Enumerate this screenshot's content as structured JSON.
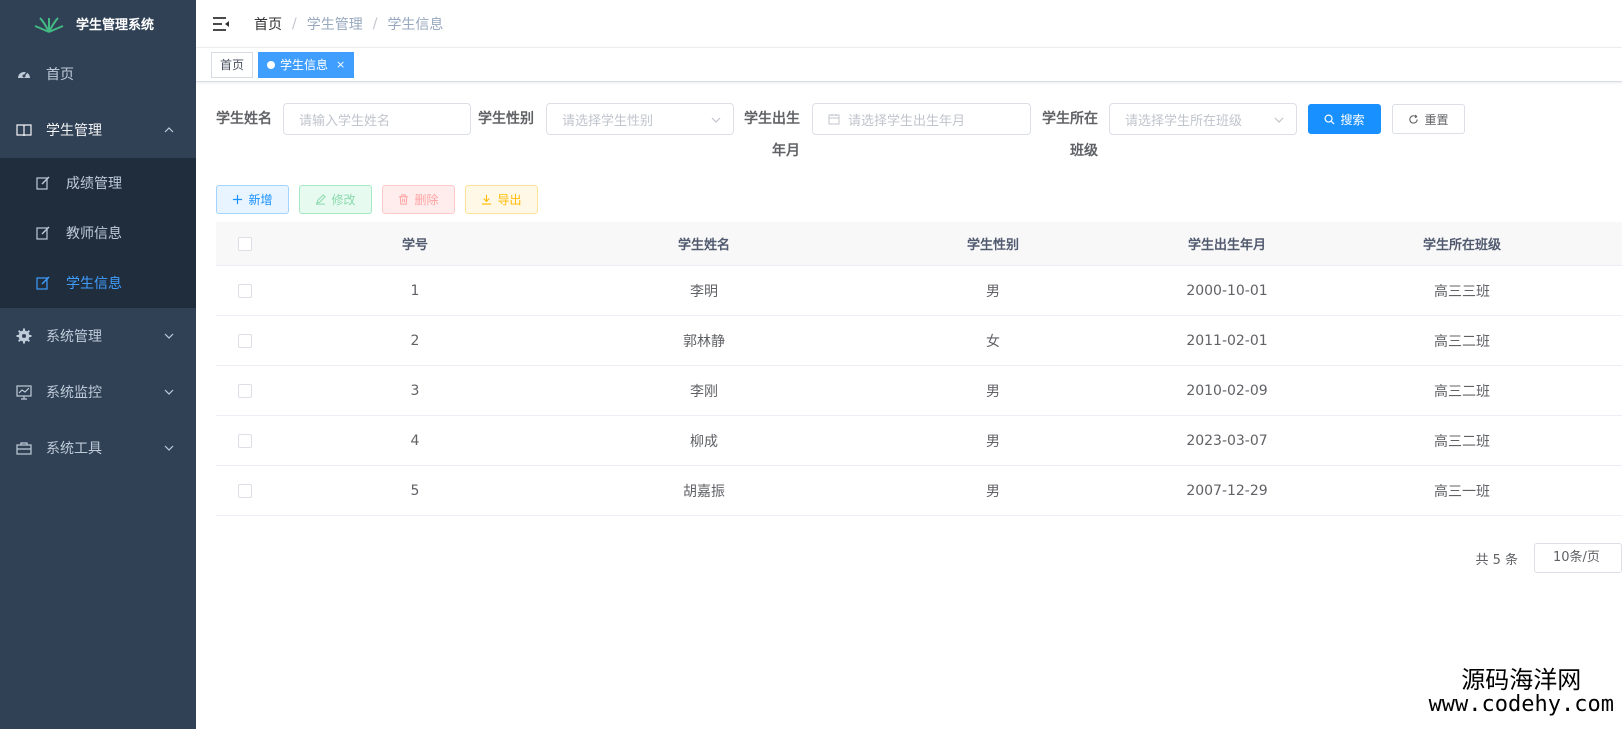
{
  "app": {
    "title": "学生管理系统"
  },
  "sidebar": {
    "items": [
      {
        "label": "首页",
        "icon": "dashboard-icon"
      },
      {
        "label": "学生管理",
        "icon": "book-icon",
        "expanded": true,
        "children": [
          {
            "label": "成绩管理",
            "icon": "edit-icon"
          },
          {
            "label": "教师信息",
            "icon": "edit-icon"
          },
          {
            "label": "学生信息",
            "icon": "edit-icon",
            "active": true
          }
        ]
      },
      {
        "label": "系统管理",
        "icon": "gear-icon"
      },
      {
        "label": "系统监控",
        "icon": "monitor-icon"
      },
      {
        "label": "系统工具",
        "icon": "toolbox-icon"
      }
    ]
  },
  "breadcrumb": [
    "首页",
    "学生管理",
    "学生信息"
  ],
  "tags": [
    {
      "label": "首页",
      "active": false
    },
    {
      "label": "学生信息",
      "active": true,
      "close": "×"
    }
  ],
  "search": {
    "name_label": "学生姓名",
    "name_placeholder": "请输入学生姓名",
    "gender_label": "学生性别",
    "gender_placeholder": "请选择学生性别",
    "birth_label_line1": "学生出生",
    "birth_label_line2": "年月",
    "birth_placeholder": "请选择学生出生年月",
    "class_label_line1": "学生所在",
    "class_label_line2": "班级",
    "class_placeholder": "请选择学生所在班级",
    "search_btn": "搜索",
    "reset_btn": "重置"
  },
  "toolbar": {
    "add": "新增",
    "edit": "修改",
    "delete": "删除",
    "export": "导出"
  },
  "table": {
    "columns": [
      "学号",
      "学生姓名",
      "学生性别",
      "学生出生年月",
      "学生所在班级"
    ],
    "rows": [
      [
        "1",
        "李明",
        "男",
        "2000-10-01",
        "高三三班"
      ],
      [
        "2",
        "郭林静",
        "女",
        "2011-02-01",
        "高三二班"
      ],
      [
        "3",
        "李刚",
        "男",
        "2010-02-09",
        "高三二班"
      ],
      [
        "4",
        "柳成",
        "男",
        "2023-03-07",
        "高三二班"
      ],
      [
        "5",
        "胡嘉振",
        "男",
        "2007-12-29",
        "高三一班"
      ]
    ]
  },
  "pagination": {
    "total": "共 5 条",
    "page_size": "10条/页"
  },
  "watermark": {
    "line1": "源码海洋网",
    "line2": "www.codehy.com"
  },
  "colors": {
    "sidebar_bg": "#304156",
    "submenu_bg": "#1f2d3d",
    "primary": "#1890ff",
    "active_menu": "#409eff"
  }
}
